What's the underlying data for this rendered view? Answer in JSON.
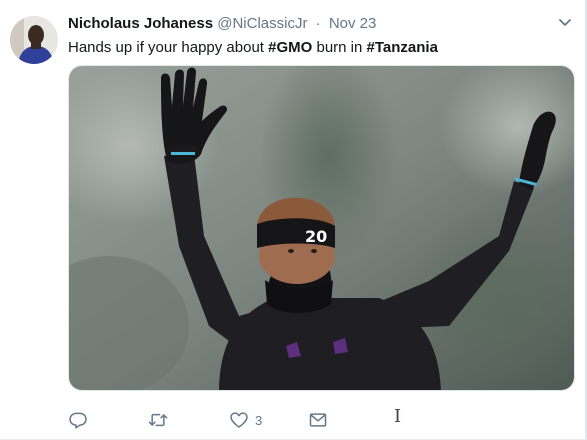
{
  "tweet": {
    "author": {
      "name": "Nicholaus Johaness",
      "handle": "@NiClassicJr",
      "separator": "·",
      "date": "Nov 23",
      "avatar": "person-avatar"
    },
    "text": {
      "part1": "Hands up if your happy about ",
      "hashtag1": "#",
      "hashtag1_word": "GMO",
      "part2": " burn in ",
      "hashtag2": "#",
      "hashtag2_word": "Tanzania"
    },
    "media": {
      "headband_number": "20"
    },
    "actions": {
      "reply_icon": "reply-icon",
      "retweet_icon": "retweet-icon",
      "like_icon": "heart-icon",
      "like_count": "3",
      "dm_icon": "envelope-icon"
    },
    "menu_icon": "chevron-down-icon",
    "colors": {
      "primary_text": "#14171a",
      "secondary_text": "#657786",
      "border": "#e1e8ed"
    }
  }
}
